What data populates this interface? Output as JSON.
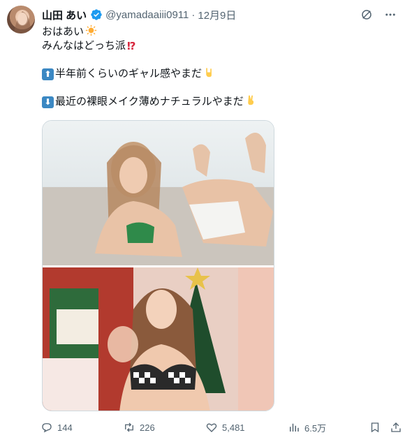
{
  "user": {
    "name": "山田 あい",
    "handle": "@yamadaaiii0911",
    "separator": "·",
    "date": "12月9日"
  },
  "post": {
    "lines": [
      "おはあい",
      "みんなはどっち派",
      "",
      "半年前くらいのギャル感やまだ",
      "",
      "最近の裸眼メイク薄めナチュラルやまだ"
    ],
    "emojis": {
      "sun": "☀",
      "question": "⁉",
      "up_arrow": "⬆",
      "horns": "🤘",
      "down_arrow": "⬇",
      "peace": "✌"
    }
  },
  "media": {
    "image1_alt": "woman in green bikini lying on a beach",
    "image2_alt": "woman in checkered bikini in front of Christmas decorations"
  },
  "actions": {
    "replies": "144",
    "reposts": "226",
    "likes": "5,481",
    "views": "6.5万"
  },
  "colors": {
    "text": "#0f1419",
    "muted": "#536471",
    "verified": "#1d9bf0",
    "border": "#cfd9de"
  },
  "icons": [
    "verified-badge-icon",
    "grok-icon",
    "more-icon",
    "reply-icon",
    "repost-icon",
    "like-icon",
    "views-icon",
    "bookmark-icon",
    "share-icon"
  ]
}
